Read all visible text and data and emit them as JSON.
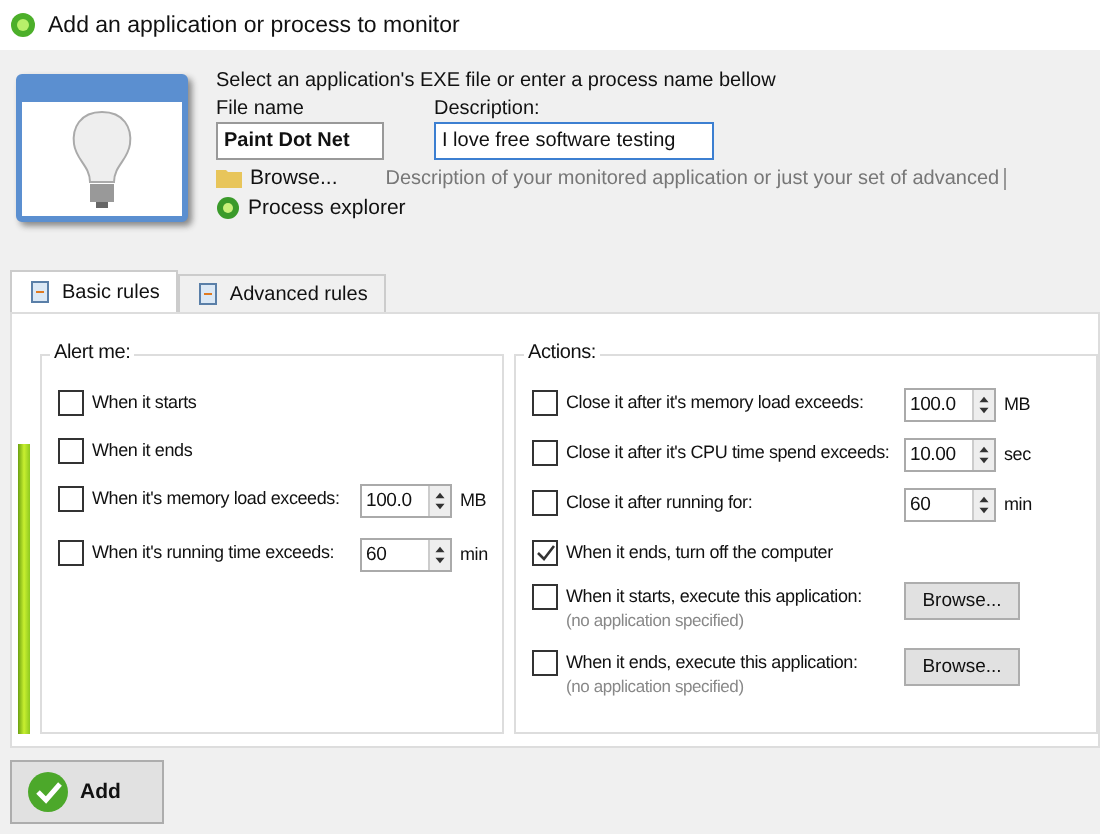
{
  "window": {
    "title": "Add an application or process to monitor"
  },
  "header": {
    "instruction": "Select an application's EXE file or enter a process name bellow",
    "file_name_label": "File name",
    "file_name_value": "Paint Dot Net",
    "description_label": "Description:",
    "description_value": "I love free software testing",
    "browse_link": "Browse...",
    "description_hint": "Description of your monitored application or just your set of advanced",
    "process_explorer_link": "Process explorer"
  },
  "tabs": [
    {
      "label": "Basic rules",
      "selected": true
    },
    {
      "label": "Advanced rules",
      "selected": false
    }
  ],
  "alert_group": {
    "title": "Alert me:",
    "rows": [
      {
        "kind": "check",
        "label": "When it starts",
        "checked": false
      },
      {
        "kind": "check",
        "label": "When it ends",
        "checked": false
      },
      {
        "kind": "spin",
        "label": "When it's memory load exceeds:",
        "checked": false,
        "value": "100.0",
        "unit": "MB"
      },
      {
        "kind": "spin",
        "label": "When it's running time exceeds:",
        "checked": false,
        "value": "60",
        "unit": "min"
      }
    ]
  },
  "actions_group": {
    "title": "Actions:",
    "rows": [
      {
        "kind": "spin",
        "label": "Close it after it's memory load exceeds:",
        "checked": false,
        "value": "100.0",
        "unit": "MB"
      },
      {
        "kind": "spin",
        "label": "Close it after it's CPU time spend exceeds:",
        "checked": false,
        "value": "10.00",
        "unit": "sec"
      },
      {
        "kind": "spin",
        "label": "Close it after running for:",
        "checked": false,
        "value": "60",
        "unit": "min"
      },
      {
        "kind": "check",
        "label": "When it ends, turn off the computer",
        "checked": true
      },
      {
        "kind": "browse",
        "label": "When it starts, execute this application:",
        "note": "(no application specified)",
        "checked": false,
        "button": "Browse..."
      },
      {
        "kind": "browse",
        "label": "When it ends, execute this application:",
        "note": "(no application specified)",
        "checked": false,
        "button": "Browse..."
      }
    ]
  },
  "add_button": "Add"
}
